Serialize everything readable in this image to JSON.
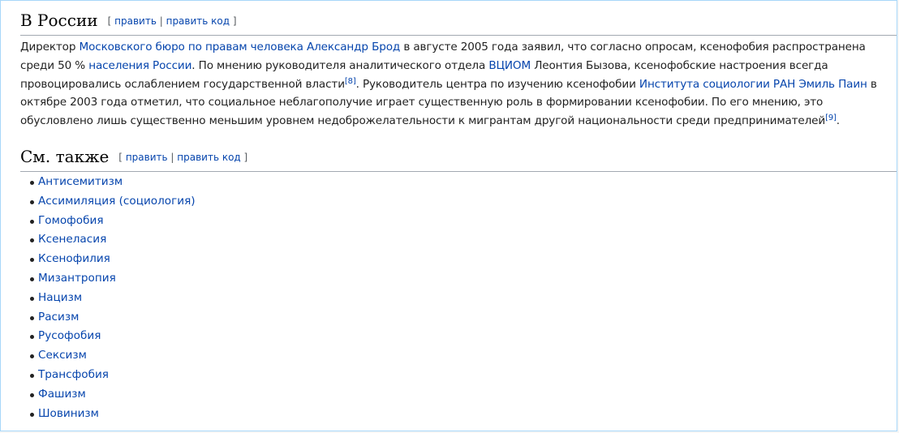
{
  "section_russia": {
    "title": "В России",
    "edit_open": "[",
    "edit_label": "править",
    "edit_sep": "|",
    "edit_code_label": "править код",
    "edit_close": "]"
  },
  "paragraph": {
    "t1": "Директор ",
    "l1": "Московского бюро по правам человека",
    "t2": " ",
    "l2": "Александр Брод",
    "t3": " в августе 2005 года заявил, что согласно опросам, ксенофобия распространена среди 50 % ",
    "l3": "населения России",
    "t4": ". По мнению руководителя аналитического отдела ",
    "l4": "ВЦИОМ",
    "t5": " Леонтия Бызова, ксенофобские настроения всегда провоцировались ослаблением государственной власти",
    "ref1": "[8]",
    "t6": ". Руководитель центра по изучению ксенофобии ",
    "l5": "Института социологии РАН",
    "t7": " ",
    "l6": "Эмиль Паин",
    "t8": " в октябре 2003 года отметил, что социальное неблагополучие играет существенную роль в формировании ксенофобии. По его мнению, это обусловлено лишь существенно меньшим уровнем недоброжелательности к мигрантам другой национальности среди предпринимателей",
    "ref2": "[9]",
    "t9": "."
  },
  "section_see_also": {
    "title": "См. также",
    "edit_open": "[",
    "edit_label": "править",
    "edit_sep": "|",
    "edit_code_label": "править код",
    "edit_close": "]"
  },
  "see_also_items": [
    "Антисемитизм",
    "Ассимиляция (социология)",
    "Гомофобия",
    "Ксенеласия",
    "Ксенофилия",
    "Мизантропия",
    "Нацизм",
    "Расизм",
    "Русофобия",
    "Сексизм",
    "Трансфобия",
    "Фашизм",
    "Шовинизм"
  ],
  "colors": {
    "link": "#0645ad",
    "text": "#222222",
    "heading_rule": "#a2a9b1"
  }
}
